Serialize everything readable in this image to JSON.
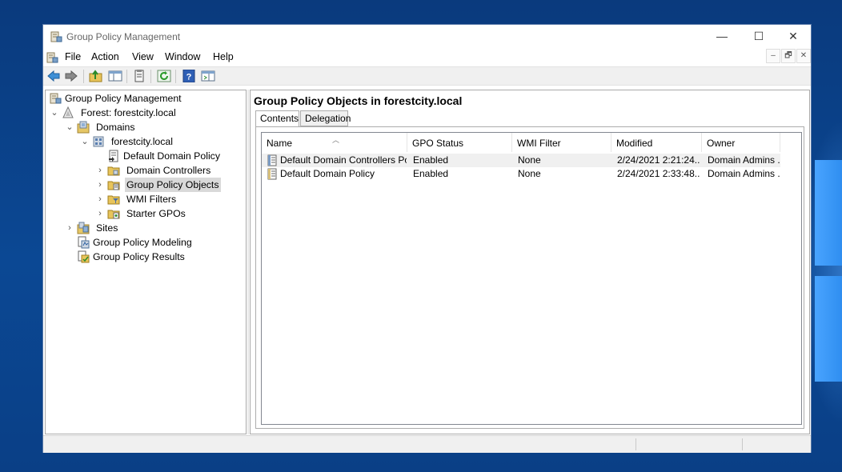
{
  "window": {
    "title": "Group Policy Management",
    "controls": {
      "minimize": "—",
      "maximize": "☐",
      "close": "✕"
    }
  },
  "menu": [
    "File",
    "Action",
    "View",
    "Window",
    "Help"
  ],
  "mdi_controls": {
    "minimize": "–",
    "restore": "🗗",
    "close": "✕"
  },
  "toolbar": [
    "back-icon",
    "forward-icon",
    "up-folder-icon",
    "show-hide-tree-icon",
    "properties-icon",
    "refresh-icon",
    "help-icon",
    "console-icon"
  ],
  "tree": {
    "root": "Group Policy Management",
    "forest": "Forest: forestcity.local",
    "domains": "Domains",
    "domain": "forestcity.local",
    "ddp": "Default Domain Policy",
    "dc": "Domain Controllers",
    "gpo": "Group Policy Objects",
    "wmi": "WMI Filters",
    "starter": "Starter GPOs",
    "sites": "Sites",
    "modeling": "Group Policy Modeling",
    "results": "Group Policy Results"
  },
  "main": {
    "title": "Group Policy Objects in forestcity.local",
    "tabs": [
      "Contents",
      "Delegation"
    ],
    "columns": [
      "Name",
      "GPO Status",
      "WMI Filter",
      "Modified",
      "Owner"
    ],
    "rows": [
      {
        "name": "Default Domain Controllers Policy",
        "status": "Enabled",
        "wmi": "None",
        "modified": "2/24/2021 2:21:24...",
        "owner": "Domain Admins ..."
      },
      {
        "name": "Default Domain Policy",
        "status": "Enabled",
        "wmi": "None",
        "modified": "2/24/2021 2:33:48...",
        "owner": "Domain Admins ..."
      }
    ]
  },
  "colors": {
    "desktop": "#0a3f86",
    "selection": "#d9d9d9"
  }
}
